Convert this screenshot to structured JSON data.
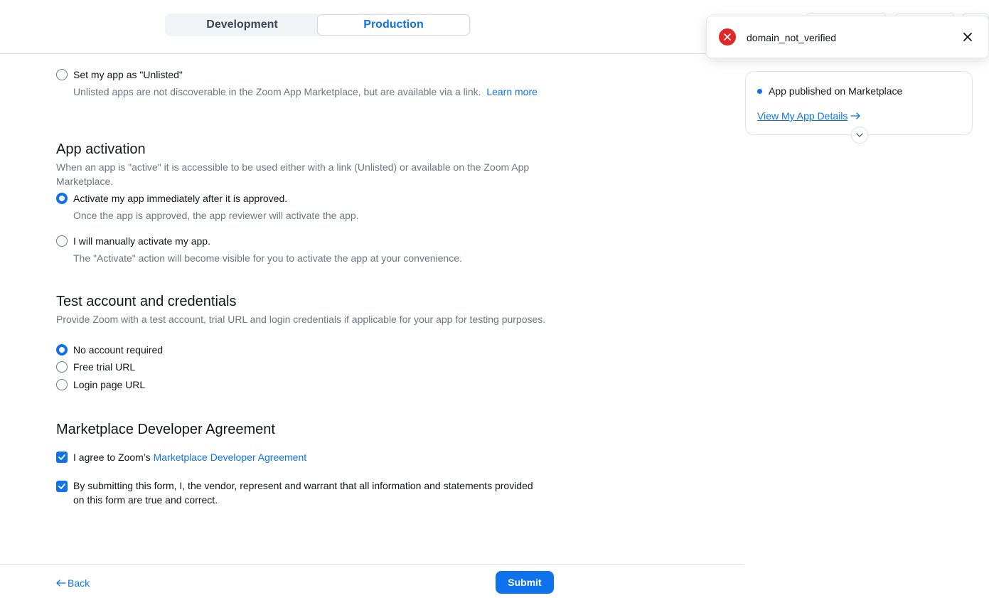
{
  "env_switch": {
    "tabs": [
      "Development",
      "Production"
    ],
    "active": "Production"
  },
  "unlisted": {
    "label": "Set my app as \"Unlisted\"",
    "desc": "Unlisted apps are not discoverable in the Zoom App Marketplace, but are available via a link.",
    "learn_more": "Learn more"
  },
  "activation": {
    "title": "App activation",
    "desc": "When an app is \"active\" it is accessible to be used either with a link (Unlisted) or available on the Zoom App Marketplace.",
    "opt1": {
      "label": "Activate my app immediately after it is approved.",
      "sub": "Once the app is approved, the app reviewer will activate the app."
    },
    "opt2": {
      "label": "I will manually activate my app.",
      "sub": "The \"Activate\" action will become visible for you to activate the app at your convenience."
    }
  },
  "test_account": {
    "title": "Test account and credentials",
    "desc": "Provide Zoom with a test account, trial URL and login credentials if applicable for your app for testing purposes.",
    "options": [
      "No account required",
      "Free trial URL",
      "Login page URL"
    ],
    "selected": "No account required"
  },
  "agreement": {
    "title": "Marketplace Developer Agreement",
    "agree_prefix": "I agree to Zoom’s ",
    "agree_link": "Marketplace Developer Agreement",
    "warrant": "By submitting this form, I, the vendor, represent and warrant that all information and statements provided on this form are true and correct."
  },
  "footer": {
    "back": "Back",
    "submit": "Submit"
  },
  "status_card": {
    "status": "App published on Marketplace",
    "details_link": "View My App Details"
  },
  "toast": {
    "message": "domain_not_verified"
  },
  "colors": {
    "accent": "#0e72ed",
    "error": "#e02828"
  }
}
